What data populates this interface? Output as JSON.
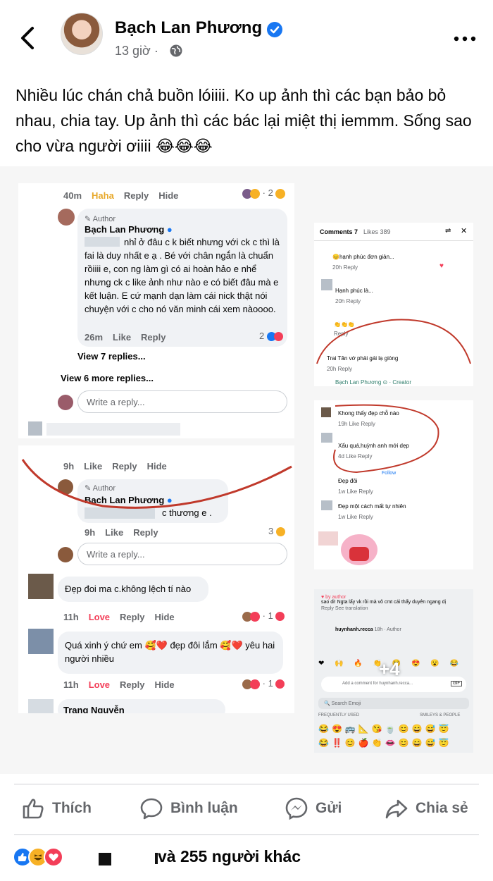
{
  "header": {
    "author_name": "Bạch Lan Phương",
    "time": "13 giờ",
    "separator": "·",
    "icons": [
      "back-arrow-icon",
      "verified-badge-icon",
      "globe-icon",
      "more-dots-icon"
    ]
  },
  "caption": "Nhiều lúc chán chả buồn lóiiii. Ko up ảnh thì các bạn bảo bỏ nhau, chia tay. Up ảnh thì các bác lại miệt thị iemmm. Sống sao cho vừa người ơiiii 😂😂😂",
  "shot1": {
    "top_meta": {
      "time": "40m",
      "haha": "Haha",
      "reply": "Reply",
      "hide": "Hide",
      "count": "2"
    },
    "author_tag": "Author",
    "name": "Bạch Lan Phương",
    "comment": "nhỉ ở đâu c k biết nhưng với ck c thì là fai là duy nhất e ạ . Bé với chân ngắn là chuẩn rồiiii e, con ng làm gì có ai hoàn hảo e nhể nhưng ck c like ảnh như nào e có biết đâu mà e kết luận. E cứ mạnh dạn làm cái nick thật nói chuyện với c cho nó văn minh cái xem nàoooo.",
    "meta": {
      "time": "26m",
      "like": "Like",
      "reply": "Reply",
      "count": "2"
    },
    "view7": "View 7 replies...",
    "view6": "View 6 more replies...",
    "write_reply": "Write a reply..."
  },
  "shot2": {
    "meta1": {
      "time": "9h",
      "like": "Like",
      "reply": "Reply",
      "hide": "Hide"
    },
    "author_tag": "Author",
    "name": "Bạch Lan Phương",
    "comment": "c thương e .",
    "meta2": {
      "time": "9h",
      "like": "Like",
      "reply": "Reply",
      "count": "3"
    },
    "write_reply": "Write a reply...",
    "c1": "Đẹp đoi ma c.không lệch tí nào",
    "c1_meta": {
      "time": "11h",
      "love": "Love",
      "reply": "Reply",
      "hide": "Hide",
      "count": "1"
    },
    "c2": "Quá xinh ý chứ em 🥰❤️ đẹp đôi lắm 🥰❤️ yêu hai người nhiều",
    "c2_meta": {
      "time": "11h",
      "love": "Love",
      "reply": "Reply",
      "hide": "Hide",
      "count": "1"
    },
    "c3_name": "Trang Nguyễn"
  },
  "shot3": {
    "tab_comments": "Comments 7",
    "tab_likes": "Likes 389",
    "rows": [
      {
        "text": "😊hạnh phúc đơn giản...",
        "meta": "20h  Reply"
      },
      {
        "text": "Hạnh phúc là...",
        "meta": "20h  Reply"
      },
      {
        "text": "👏👏👏",
        "meta": "Reply"
      },
      {
        "text": "Trai Tân vớ phải gái lạ giòng",
        "meta": "20h  Reply"
      }
    ],
    "creator": "Bạch Lan Phương ⊙ · Creator"
  },
  "shot4": {
    "rows": [
      {
        "text": "Khong thấy đẹp chỗ nào",
        "meta": "19h  Like  Reply"
      },
      {
        "text": "Xấu quá,huỳnh anh mới dẹp",
        "meta": "4d  Like  Reply"
      },
      {
        "text": "Đẹp đôi",
        "meta": "1w  Like  Reply"
      },
      {
        "text": "Đẹp một cách mất tự nhiên",
        "meta": "1w  Like  Reply"
      }
    ],
    "follow": "Follow"
  },
  "shot5": {
    "line1": "sao di! Ngta lấy vk rồi mà vô cmt cái thấy duyên ngang dị",
    "by_author": "♥ by author",
    "reply": "Reply",
    "see_translation": "See translation",
    "user": "huynhanh.recca",
    "user_meta": "18h · Author",
    "plus": "+4",
    "add_comment": "Add a comment for huynhanh.recca...",
    "gif": "GIF",
    "search_emoji": "Search Emoji",
    "freq": "FREQUENTLY USED",
    "smileys": "SMILEYS & PEOPLE"
  },
  "actions": {
    "like": "Thích",
    "comment": "Bình luận",
    "send": "Gửi",
    "share": "Chia sẻ"
  },
  "reactions": {
    "text": "và 255 người khác",
    "icons": [
      "like-reaction-icon",
      "haha-reaction-icon",
      "love-reaction-icon"
    ]
  },
  "colors": {
    "facebook_blue": "#1877f2",
    "love_red": "#f33e58",
    "haha_yellow": "#f7b125",
    "muted_text": "#65676b"
  }
}
